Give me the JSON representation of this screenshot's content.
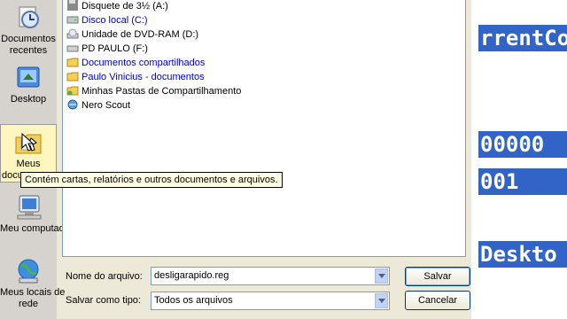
{
  "places": [
    {
      "name": "documentos-recentes",
      "line1": "Documentos",
      "line2": "recentes"
    },
    {
      "name": "desktop",
      "line1": "Desktop",
      "line2": ""
    },
    {
      "name": "meus-documentos",
      "line1": "Meus",
      "line2": "documentos"
    },
    {
      "name": "meu-computador",
      "line1": "Meu computador",
      "line2": ""
    },
    {
      "name": "meus-locais-de-rede",
      "line1": "Meus locais de",
      "line2": "rede"
    }
  ],
  "files": [
    {
      "label": "Disquete de 3½ (A:)",
      "icon": "floppy-icon",
      "blue": false
    },
    {
      "label": "Disco local (C:)",
      "icon": "hard-drive-icon",
      "blue": true
    },
    {
      "label": "Unidade de DVD-RAM (D:)",
      "icon": "dvd-drive-icon",
      "blue": false
    },
    {
      "label": "PD PAULO (F:)",
      "icon": "removable-drive-icon",
      "blue": false
    },
    {
      "label": "Documentos compartilhados",
      "icon": "folder-icon",
      "blue": true
    },
    {
      "label": "Paulo Vinicius - documentos",
      "icon": "folder-icon",
      "blue": true
    },
    {
      "label": "Minhas Pastas de Compartilhamento",
      "icon": "shared-folder-icon",
      "blue": false
    },
    {
      "label": "Nero Scout",
      "icon": "nero-scout-icon",
      "blue": false
    }
  ],
  "filename": {
    "label": "Nome do arquivo:",
    "value": "desligarapido.reg"
  },
  "filetype": {
    "label": "Salvar como tipo:",
    "value": "Todos os arquivos"
  },
  "buttons": {
    "save": "Salvar",
    "cancel": "Cancelar"
  },
  "tooltip": "Contém cartas, relatórios e outros documentos e arquivos.",
  "background_window": {
    "lines": [
      "rrentCo",
      "00000",
      "001",
      "Deskto"
    ]
  },
  "colors": {
    "highlight": "#3264c8",
    "tooltip_bg": "#ffffe1",
    "link_blue": "#0000cc"
  }
}
